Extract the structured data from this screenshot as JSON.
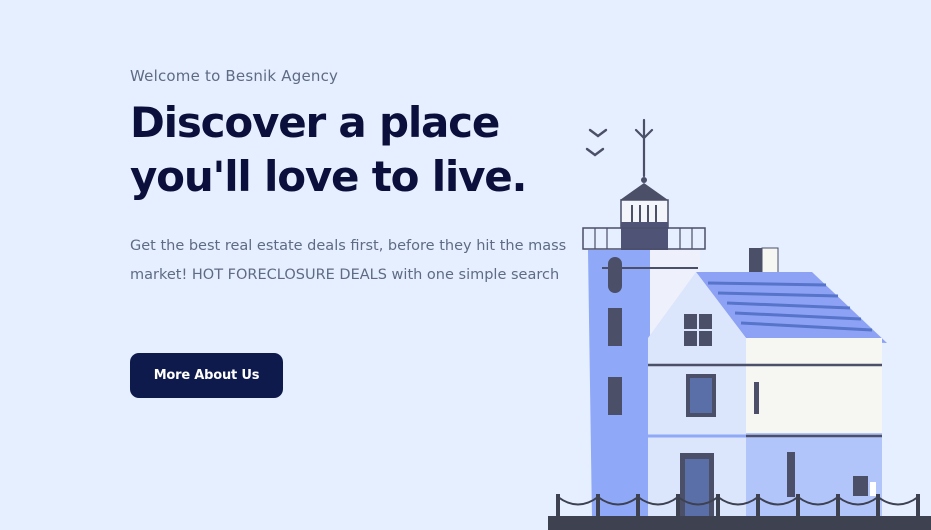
{
  "hero": {
    "eyebrow": "Welcome to Besnik Agency",
    "headline_line1": "Discover a place",
    "headline_line2": "you'll love to live.",
    "subtext": "Get the best real estate deals first, before they hit the mass market! HOT FORECLOSURE DEALS with one simple search",
    "cta_label": "More About Us"
  },
  "illustration": {
    "subject": "lighthouse-house-illustration",
    "colors": {
      "tower": "#8fa8f7",
      "house_wall": "#dbe5fb",
      "roof": "#8ea2f5",
      "roof_stripes": "#5674c9",
      "annex_wall": "#f6f6f3",
      "dark": "#4b4f68",
      "fence": "#3d4150"
    }
  },
  "colors": {
    "background": "#e5efff",
    "headline": "#0b0f3b",
    "body_text": "#5f6b84",
    "button_bg": "#0e1a4c",
    "button_text": "#ffffff"
  }
}
